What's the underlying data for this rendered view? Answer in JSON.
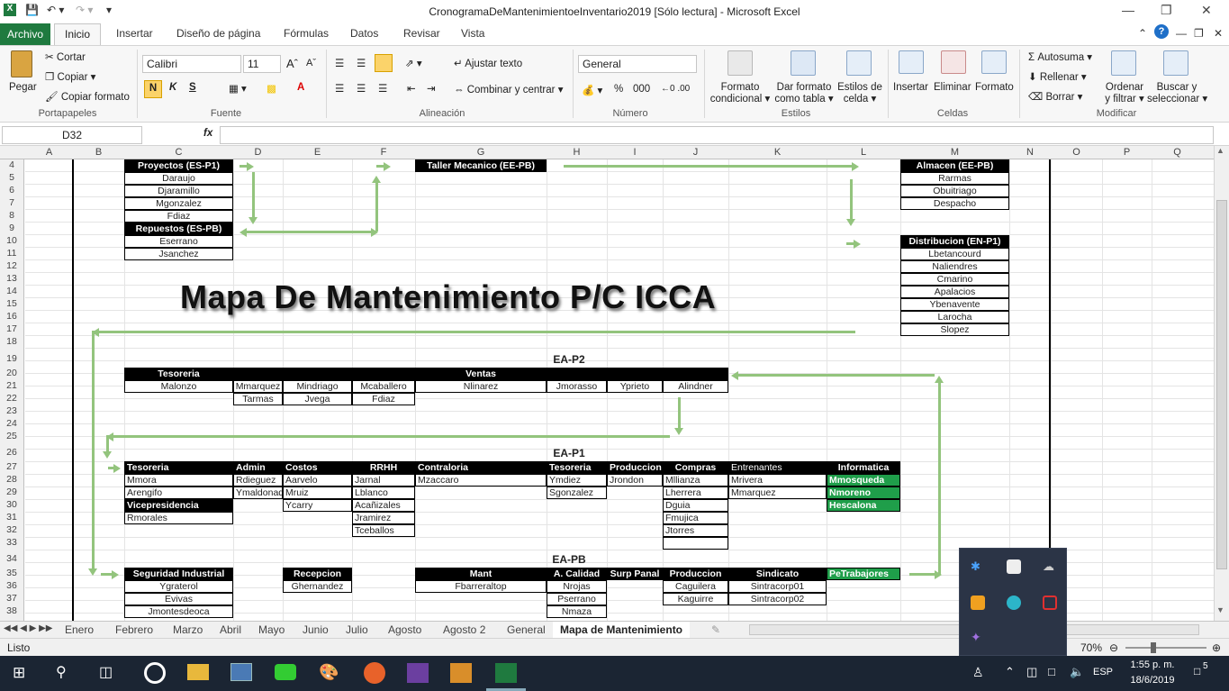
{
  "window": {
    "title": "CronogramaDeMantenimientoeInventario2019  [Sólo lectura]  -  Microsoft Excel",
    "question": "?"
  },
  "ribbon_tabs": {
    "file": "Archivo",
    "home": "Inicio",
    "insert": "Insertar",
    "layout": "Diseño de página",
    "formulas": "Fórmulas",
    "data": "Datos",
    "review": "Revisar",
    "view": "Vista"
  },
  "clipboard": {
    "paste": "Pegar",
    "cut": "Cortar",
    "copy": "Copiar",
    "format_painter": "Copiar formato",
    "group": "Portapapeles"
  },
  "font": {
    "name": "Calibri",
    "size": "11",
    "bold": "N",
    "italic": "K",
    "underline": "S",
    "group": "Fuente"
  },
  "alignment": {
    "wrap": "Ajustar texto",
    "merge": "Combinar y centrar",
    "group": "Alineación"
  },
  "number": {
    "format": "General",
    "percent": "%",
    "thousands": "000",
    "group": "Número"
  },
  "styles": {
    "cond_line1": "Formato",
    "cond_line2": "condicional",
    "table_line1": "Dar formato",
    "table_line2": "como tabla",
    "cell_line1": "Estilos de",
    "cell_line2": "celda",
    "group": "Estilos"
  },
  "cells": {
    "insert": "Insertar",
    "delete": "Eliminar",
    "format": "Formato",
    "group": "Celdas"
  },
  "editing": {
    "autosum": "Autosuma",
    "fill": "Rellenar",
    "clear": "Borrar",
    "sort_line1": "Ordenar",
    "sort_line2": "y filtrar",
    "find_line1": "Buscar y",
    "find_line2": "seleccionar",
    "group": "Modificar"
  },
  "namebox": "D32",
  "fx": "fx",
  "columns": [
    "A",
    "B",
    "C",
    "D",
    "E",
    "F",
    "G",
    "H",
    "I",
    "J",
    "K",
    "L",
    "M",
    "N",
    "O",
    "P",
    "Q"
  ],
  "rows": [
    "4",
    "5",
    "6",
    "7",
    "8",
    "9",
    "10",
    "11",
    "12",
    "13",
    "14",
    "15",
    "16",
    "17",
    "18",
    "19",
    "20",
    "21",
    "22",
    "23",
    "24",
    "25",
    "26",
    "27",
    "28",
    "29",
    "30",
    "31",
    "32",
    "33",
    "34",
    "35",
    "36",
    "37",
    "38"
  ],
  "map_title": "Mapa De Mantenimiento  P/C ICCA",
  "sections": {
    "p2": "EA-P2",
    "p1": "EA-P1",
    "pb": "EA-PB"
  },
  "blocks": {
    "proyectos": {
      "title": "Proyectos (ES-P1)",
      "items": [
        "Daraujo",
        "Djaramillo",
        "Mgonzalez",
        "Fdiaz"
      ]
    },
    "repuestos": {
      "title": "Repuestos (ES-PB)",
      "items": [
        "Eserrano",
        "Jsanchez"
      ]
    },
    "taller": {
      "title": "Taller Mecanico (EE-PB)"
    },
    "almacen": {
      "title": "Almacen (EE-PB)",
      "items": [
        "Rarmas",
        "Obuitriago",
        "Despacho"
      ]
    },
    "distribucion": {
      "title": "Distribucion (EN-P1)",
      "items": [
        "Lbetancourd",
        "Naliendres",
        "Cmarino",
        "Apalacios",
        "Ybenavente",
        "Larocha",
        "Slopez"
      ]
    }
  },
  "p2": {
    "tesoreria": "Tesoreria",
    "ventas": "Ventas",
    "r21": [
      "Malonzo",
      "Mmarquez",
      "Mindriago",
      "Mcaballero",
      "Nlinarez",
      "Jmorasso",
      "Yprieto",
      "Alindner"
    ],
    "r22": [
      "Tarmas",
      "Jvega",
      "Fdiaz"
    ]
  },
  "p1": {
    "headers": [
      "Tesoreria",
      "Admin",
      "Costos",
      "RRHH",
      "Contraloria",
      "Tesoreria",
      "Produccion",
      "Compras",
      "Entrenantes",
      "Informatica"
    ],
    "tesoreria": [
      "Mmora",
      "Arengifo"
    ],
    "vice": "Vicepresidencia",
    "vice_item": "Rmorales",
    "admin": [
      "Rdieguez",
      "Ymaldonado"
    ],
    "costos": [
      "Aarvelo",
      "Mruiz",
      "Ycarry"
    ],
    "rrhh": [
      "Jarnal",
      "Lblanco",
      "Acañizales",
      "Jramirez",
      "Tceballos"
    ],
    "contraloria": [
      "Mzaccaro"
    ],
    "tesoreria2": [
      "Ymdiez",
      "Sgonzalez"
    ],
    "produccion": [
      "Jrondon"
    ],
    "compras": [
      "Mllianza",
      "Lherrera",
      "Dguia",
      "Fmujica",
      "Jtorres"
    ],
    "entrenantes": [
      "Mrivera",
      "Mmarquez"
    ],
    "informatica": [
      "Mmosqueda",
      "Nmoreno",
      "Hescalona"
    ]
  },
  "pb": {
    "seguridad": "Seguridad Industrial",
    "seguridad_items": [
      "Ygraterol",
      "Evivas",
      "Jmontesdeoca"
    ],
    "recepcion": "Recepcion",
    "recepcion_items": [
      "Ghernandez"
    ],
    "mant": "Mant",
    "mant_items": [
      "Fbarreraltop"
    ],
    "calidad": "A. Calidad",
    "calidad_items": [
      "Nrojas",
      "Pserrano",
      "Nmaza"
    ],
    "surp": "Surp Panal",
    "produccion": "Produccion",
    "produccion_items": [
      "Caguilera",
      "Kaguirre"
    ],
    "sindicato": "Sindicato",
    "sindicato_items": [
      "Sintracorp01",
      "Sintracorp02"
    ],
    "petrabajores": "PeTrabajores"
  },
  "sheet_tabs": [
    "Enero",
    "Febrero",
    "Marzo",
    "Abril",
    "Mayo",
    "Junio",
    "Julio",
    "Agosto",
    "Agosto 2",
    "General",
    "Mapa de Mantenimiento"
  ],
  "status": {
    "ready": "Listo",
    "zoom": "70%"
  },
  "taskbar": {
    "time": "1:55 p. m.",
    "date": "18/6/2019",
    "lang": "ESP",
    "notif": "5"
  },
  "colors": {
    "excel_green": "#1f7a3f",
    "arrow": "#93c47d",
    "header": "#000000",
    "informatica": "#1f9e4a"
  }
}
